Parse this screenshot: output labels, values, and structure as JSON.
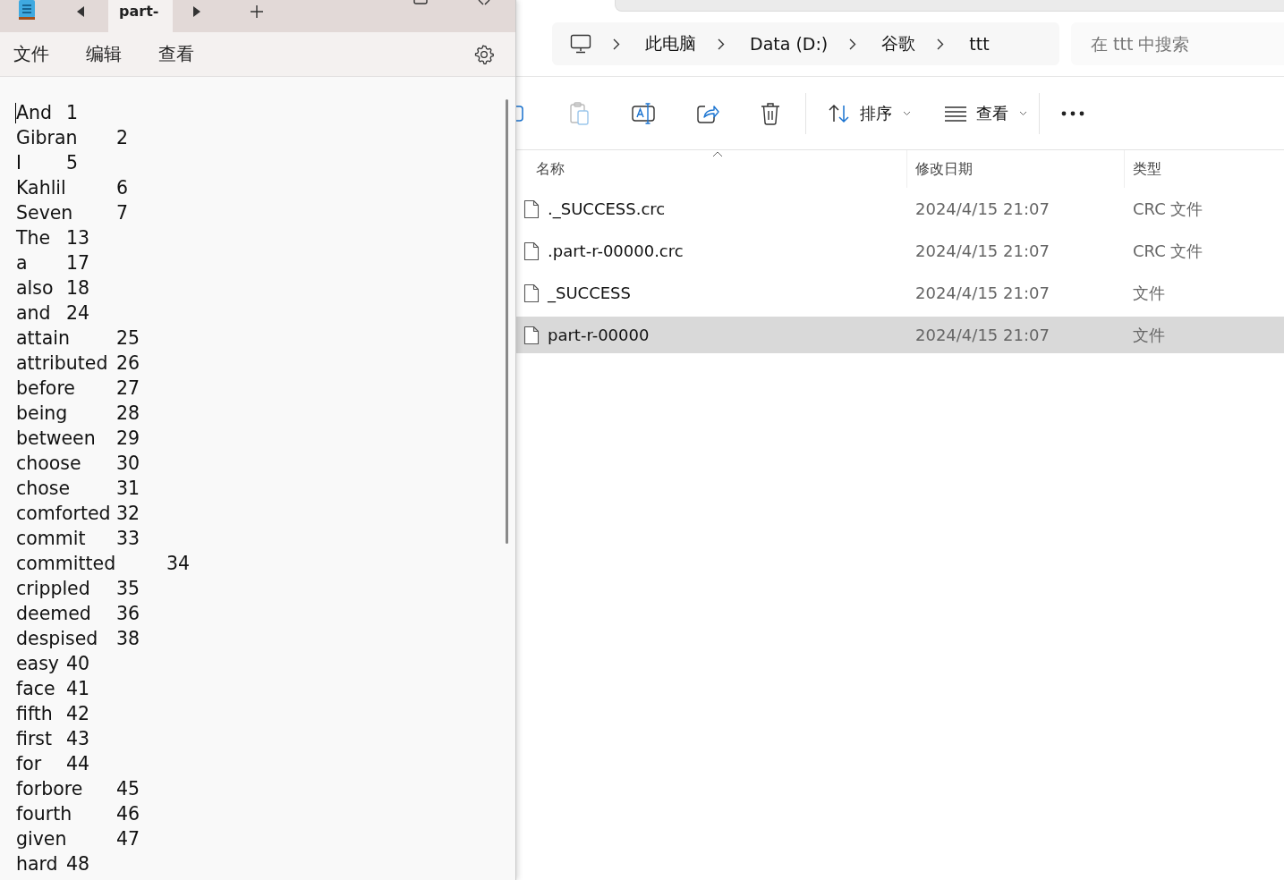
{
  "notepad": {
    "tabs": [
      {
        "label": "part-",
        "selected": true
      }
    ],
    "menu": [
      "文件",
      "编辑",
      "查看"
    ],
    "lines": [
      {
        "word": "And",
        "count": "1"
      },
      {
        "word": "Gibran",
        "count": "2"
      },
      {
        "word": "I",
        "count": "5"
      },
      {
        "word": "Kahlil",
        "count": "6"
      },
      {
        "word": "Seven",
        "count": "7"
      },
      {
        "word": "The",
        "count": "13"
      },
      {
        "word": "a",
        "count": "17"
      },
      {
        "word": "also",
        "count": "18"
      },
      {
        "word": "and",
        "count": "24"
      },
      {
        "word": "attain",
        "count": "25"
      },
      {
        "word": "attributed",
        "count": "26"
      },
      {
        "word": "before",
        "count": "27"
      },
      {
        "word": "being",
        "count": "28"
      },
      {
        "word": "between",
        "count": "29"
      },
      {
        "word": "choose",
        "count": "30"
      },
      {
        "word": "chose",
        "count": "31"
      },
      {
        "word": "comforted",
        "count": "32"
      },
      {
        "word": "commit",
        "count": "33"
      },
      {
        "word": "committed",
        "count": "34"
      },
      {
        "word": "crippled",
        "count": "35"
      },
      {
        "word": "deemed",
        "count": "36"
      },
      {
        "word": "despised",
        "count": "38"
      },
      {
        "word": "easy",
        "count": "40"
      },
      {
        "word": "face",
        "count": "41"
      },
      {
        "word": "fifth",
        "count": "42"
      },
      {
        "word": "first",
        "count": "43"
      },
      {
        "word": "for",
        "count": "44"
      },
      {
        "word": "forbore",
        "count": "45"
      },
      {
        "word": "fourth",
        "count": "46"
      },
      {
        "word": "given",
        "count": "47"
      },
      {
        "word": "hard",
        "count": "48"
      }
    ]
  },
  "explorer": {
    "breadcrumb": [
      "此电脑",
      "Data (D:)",
      "谷歌",
      "ttt"
    ],
    "search": {
      "placeholder": "在 ttt 中搜索"
    },
    "toolbar": [
      {
        "kind": "sort",
        "label": "排序"
      },
      {
        "kind": "view",
        "label": "查看"
      }
    ],
    "columns": [
      "名称",
      "修改日期",
      "类型"
    ],
    "files": [
      {
        "name": "._SUCCESS.crc",
        "date": "2024/4/15 21:07",
        "type": "CRC 文件",
        "selected": false
      },
      {
        "name": ".part-r-00000.crc",
        "date": "2024/4/15 21:07",
        "type": "CRC 文件",
        "selected": false
      },
      {
        "name": "_SUCCESS",
        "date": "2024/4/15 21:07",
        "type": "文件",
        "selected": false
      },
      {
        "name": "part-r-00000",
        "date": "2024/4/15 21:07",
        "type": "文件",
        "selected": true
      }
    ]
  }
}
